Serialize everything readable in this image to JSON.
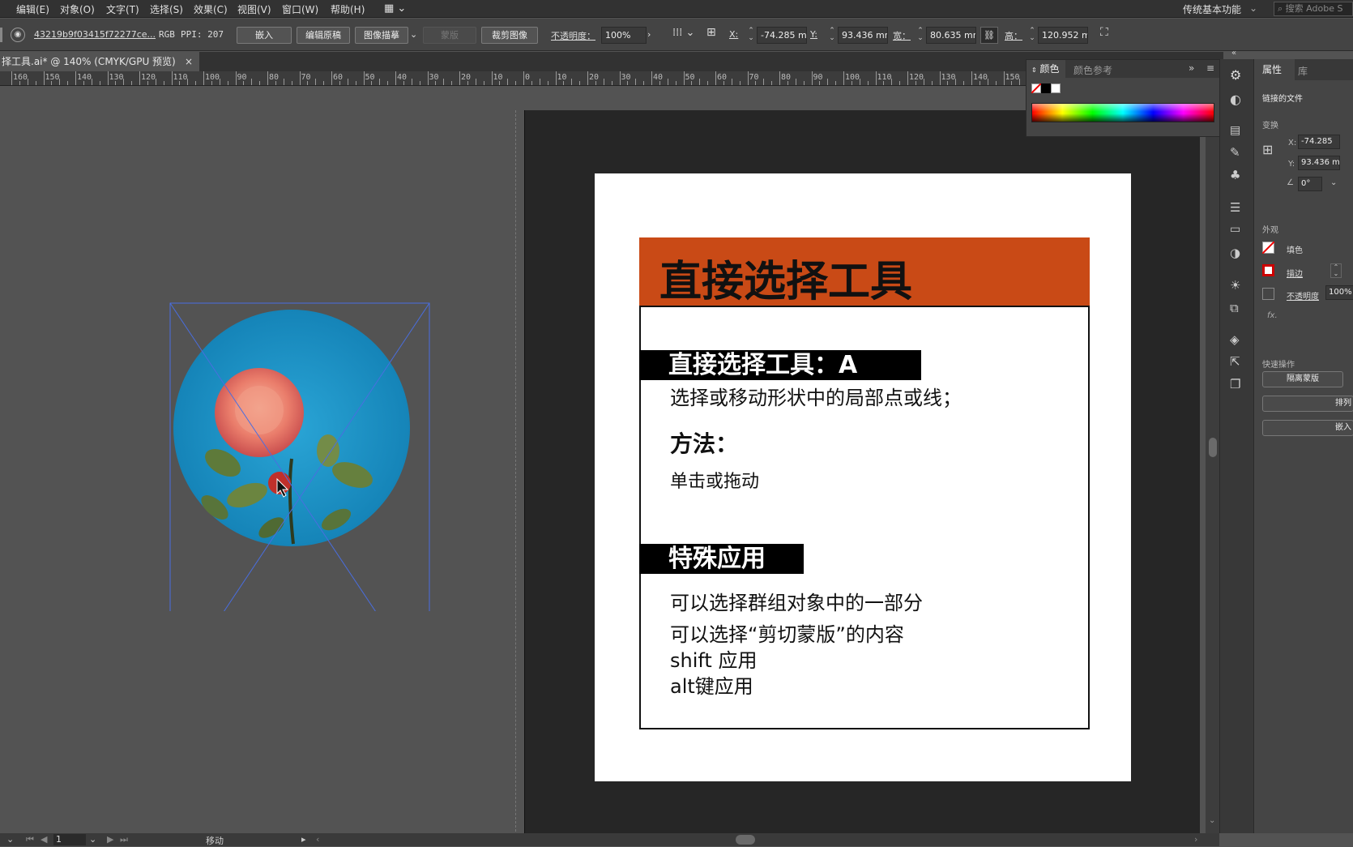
{
  "menubar": {
    "items": [
      "编辑(E)",
      "对象(O)",
      "文字(T)",
      "选择(S)",
      "效果(C)",
      "视图(V)",
      "窗口(W)",
      "帮助(H)"
    ],
    "workspace": "传统基本功能",
    "search_placeholder": "搜索 Adobe S"
  },
  "controlbar": {
    "filename": "43219b9f03415f72277ce...",
    "color_mode": "RGB",
    "ppi": "PPI: 207",
    "embed_label": "嵌入",
    "edit_original_label": "编辑原稿",
    "image_trace_label": "图像描摹",
    "mask_label": "蒙版",
    "crop_label": "裁剪图像",
    "opacity_label": "不透明度：",
    "opacity_value": "100%",
    "x_label": "X:",
    "x_value": "-74.285 m",
    "y_label": "Y:",
    "y_value": "93.436 mm",
    "w_label": "宽：",
    "w_value": "80.635 mm",
    "h_label": "高：",
    "h_value": "120.952 m"
  },
  "tabbar": {
    "doc_tab": "择工具.ai* @ 140% (CMYK/GPU 预览)",
    "close_glyph": "×"
  },
  "ruler_labels": [
    "160",
    "150",
    "140",
    "130",
    "120",
    "110",
    "100",
    "90",
    "80",
    "70",
    "60",
    "50",
    "40",
    "30",
    "20",
    "10",
    "0",
    "10",
    "20",
    "30",
    "40",
    "50",
    "60",
    "70",
    "80",
    "90",
    "100",
    "110",
    "120",
    "130",
    "140",
    "150"
  ],
  "artboard": {
    "title": "直接选择工具",
    "section1_label": "直接选择工具：A",
    "section1_desc": "选择或移动形状中的局部点或线；",
    "method_label": "方法：",
    "method_desc": "单击或拖动",
    "section2_label": "特殊应用",
    "app_line1": "可以选择群组对象中的一部分",
    "app_line2": "可以选择“剪切蒙版”的内容",
    "app_line3": "shift 应用",
    "app_line4": "alt键应用"
  },
  "color_panel": {
    "tab_color": "颜色",
    "tab_color_ref": "颜色参考"
  },
  "props_panel": {
    "tab_properties": "属性",
    "tab_library": "库",
    "linked_file": "链接的文件",
    "transform": "变换",
    "x_label": "X:",
    "x_value": "-74.285",
    "y_label": "Y:",
    "y_value": "93.436 m",
    "angle_value": "0°",
    "appearance": "外观",
    "fill_label": "填色",
    "stroke_label": "描边",
    "opacity_label": "不透明度",
    "opacity_value": "100%",
    "fx_label": "fx.",
    "quick_actions": "快速操作",
    "isolate_mask": "隔离蒙版",
    "arrange": "排列",
    "embed": "嵌入"
  },
  "statusbar": {
    "page": "1",
    "tool": "移动"
  },
  "colors": {
    "accent_orange": "#c94a16",
    "selection_blue": "#4a6ee0"
  }
}
